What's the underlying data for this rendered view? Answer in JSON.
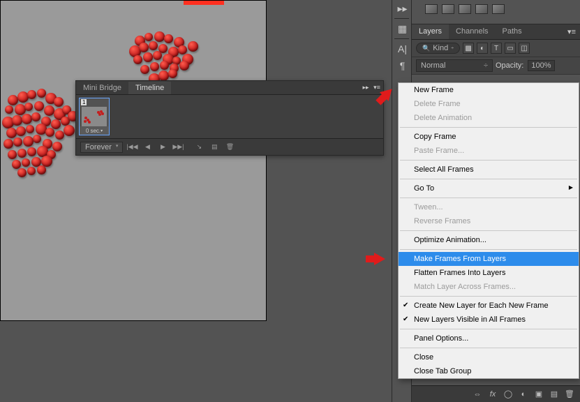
{
  "tabs": {
    "mini_bridge": "Mini Bridge",
    "timeline": "Timeline"
  },
  "timeline": {
    "frame_num": "1",
    "frame_duration": "0 sec.",
    "loop": "Forever"
  },
  "layers_panel": {
    "tabs": {
      "layers": "Layers",
      "channels": "Channels",
      "paths": "Paths"
    },
    "kind": "Kind",
    "blend_mode": "Normal",
    "opacity_label": "Opacity:",
    "opacity_value": "100%"
  },
  "context_menu": {
    "new_frame": "New Frame",
    "delete_frame": "Delete Frame",
    "delete_animation": "Delete Animation",
    "copy_frame": "Copy Frame",
    "paste_frame": "Paste Frame...",
    "select_all": "Select All Frames",
    "go_to": "Go To",
    "tween": "Tween...",
    "reverse": "Reverse Frames",
    "optimize": "Optimize Animation...",
    "make_from_layers": "Make Frames From Layers",
    "flatten": "Flatten Frames Into Layers",
    "match_layer": "Match Layer Across Frames...",
    "create_new_layer": "Create New Layer for Each New Frame",
    "new_layers_visible": "New Layers Visible in All Frames",
    "panel_options": "Panel Options...",
    "close": "Close",
    "close_group": "Close Tab Group"
  }
}
